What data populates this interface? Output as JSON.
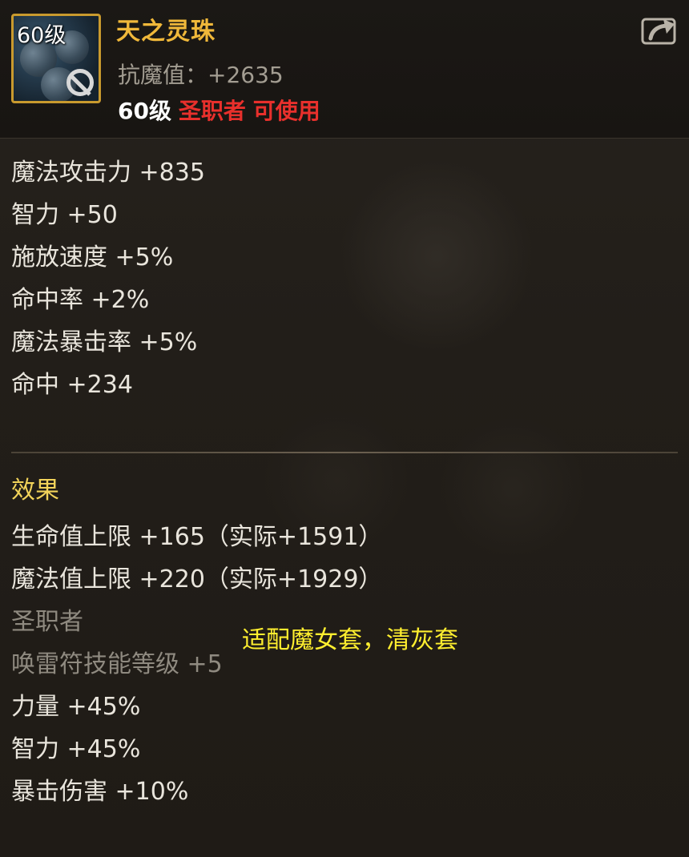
{
  "item": {
    "level_tag": "60级",
    "name": "天之灵珠",
    "sub_stat": "抗魔值：+2635",
    "requirement": {
      "level": "60级",
      "class": "圣职者",
      "usable": "可使用"
    }
  },
  "icons": {
    "share": "share-arrow-icon",
    "ban": "prohibited-icon"
  },
  "stats": [
    "魔法攻击力 +835",
    "智力 +50",
    "施放速度 +5%",
    "命中率 +2%",
    "魔法暴击率 +5%",
    "命中 +234"
  ],
  "effects": {
    "title": "效果",
    "lines": [
      {
        "text": "生命值上限 +165（实际+1591）",
        "dim": false
      },
      {
        "text": "魔法值上限 +220（实际+1929）",
        "dim": false
      },
      {
        "text": "圣职者",
        "dim": true
      },
      {
        "text": "唤雷符技能等级 +5",
        "dim": true
      },
      {
        "text": "力量 +45%",
        "dim": false
      },
      {
        "text": "智力 +45%",
        "dim": false
      },
      {
        "text": "暴击伤害 +10%",
        "dim": false
      }
    ]
  },
  "note": "适配魔女套，清灰套",
  "colors": {
    "name": "#f0b83a",
    "requirement_red": "#e8302c",
    "section_title": "#f2d35a",
    "note_yellow": "#ffef2f",
    "icon_border": "#c99a2e"
  }
}
